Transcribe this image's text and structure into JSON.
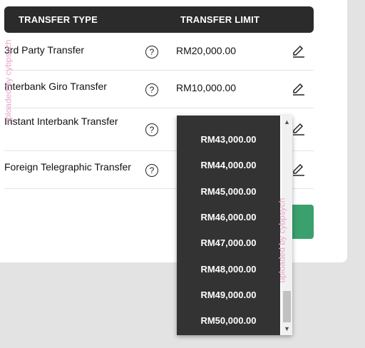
{
  "table": {
    "header_type": "TRANSFER TYPE",
    "header_limit": "TRANSFER LIMIT",
    "rows": [
      {
        "type": "3rd Party Transfer",
        "limit": "RM20,000.00"
      },
      {
        "type": "Interbank Giro Transfer",
        "limit": "RM10,000.00"
      },
      {
        "type": "Instant Interbank Transfer",
        "limit": ""
      },
      {
        "type": "Foreign Telegraphic Transfer",
        "limit": ""
      }
    ]
  },
  "dropdown": {
    "options": [
      "RM43,000.00",
      "RM44,000.00",
      "RM45,000.00",
      "RM46,000.00",
      "RM47,000.00",
      "RM48,000.00",
      "RM49,000.00",
      "RM50,000.00"
    ]
  },
  "icons": {
    "help": "question-mark-icon",
    "edit": "pencil-icon"
  },
  "watermark": "uploaded by cybpsych",
  "colors": {
    "header_bg": "#2b2b2b",
    "dropdown_bg": "#333333",
    "accent_green": "#3aa06e",
    "watermark": "#e8a6c8"
  }
}
